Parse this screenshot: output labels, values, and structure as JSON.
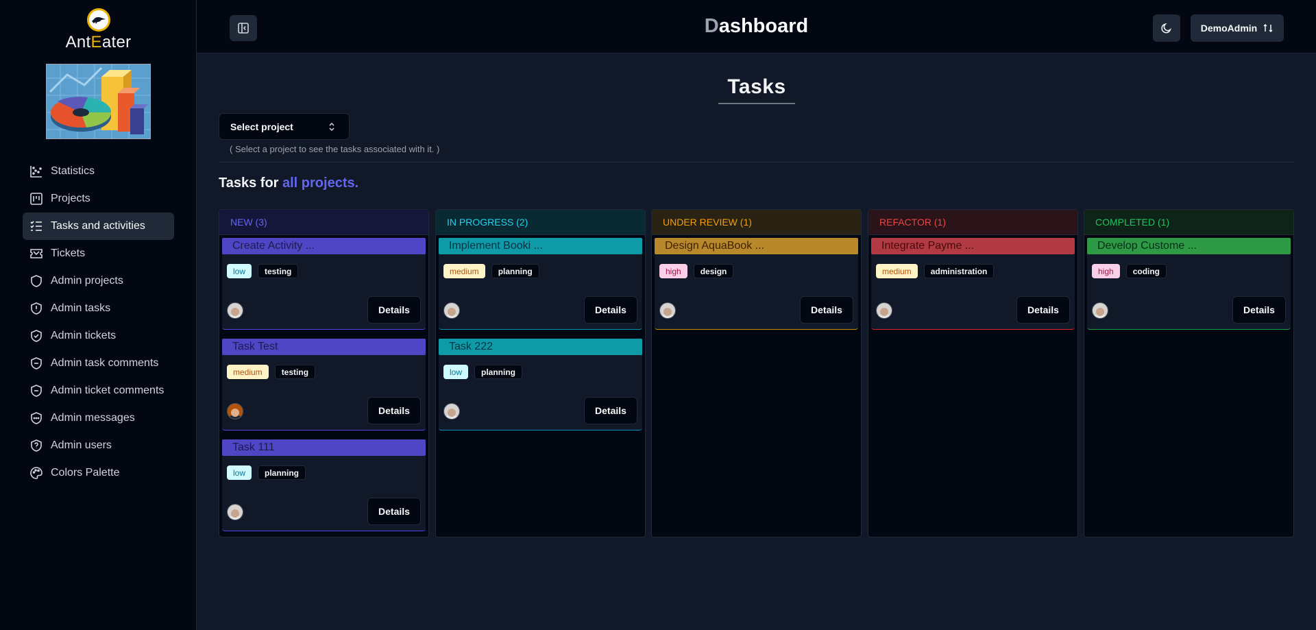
{
  "brand": {
    "name_start": "Ant",
    "name_e": "E",
    "name_end": "ater"
  },
  "sidebar": {
    "items": [
      {
        "label": "Statistics",
        "icon": "statistics-icon",
        "active": false
      },
      {
        "label": "Projects",
        "icon": "projects-icon",
        "active": false
      },
      {
        "label": "Tasks and activities",
        "icon": "tasks-icon",
        "active": true
      },
      {
        "label": "Tickets",
        "icon": "tickets-icon",
        "active": false
      },
      {
        "label": "Admin projects",
        "icon": "shield-icon",
        "active": false
      },
      {
        "label": "Admin tasks",
        "icon": "shield-alert-icon",
        "active": false
      },
      {
        "label": "Admin tickets",
        "icon": "shield-check-icon",
        "active": false
      },
      {
        "label": "Admin task comments",
        "icon": "shield-minus-icon",
        "active": false
      },
      {
        "label": "Admin ticket comments",
        "icon": "shield-minus-icon",
        "active": false
      },
      {
        "label": "Admin messages",
        "icon": "shield-ellipsis-icon",
        "active": false
      },
      {
        "label": "Admin users",
        "icon": "shield-question-icon",
        "active": false
      },
      {
        "label": "Colors Palette",
        "icon": "palette-icon",
        "active": false
      }
    ]
  },
  "header": {
    "title_first": "D",
    "title_rest": "ashboard",
    "user_label": "DemoAdmin"
  },
  "main": {
    "title": "Tasks",
    "select_label": "Select project",
    "select_hint": "( Select a project to see the tasks associated with it. )",
    "tasks_for_prefix": "Tasks for ",
    "tasks_for_highlight": "all projects.",
    "details_label": "Details"
  },
  "colors": {
    "new": "#4f46e5",
    "in_progress": "#0891b2",
    "under_review": "#ca8a04",
    "refactor": "#dc2626",
    "completed": "#16a34a"
  },
  "columns": [
    {
      "key": "new",
      "header": "NEW (3)",
      "header_color": "#6366f1",
      "header_bg": "#14163a",
      "card_bg": "#4f46c6",
      "title_color": "#1e1b4b",
      "border": "#4f46e5",
      "cards": [
        {
          "title": "Create Activity ...",
          "priority": "low",
          "category": "testing",
          "avatar": "default"
        },
        {
          "title": "Task Test",
          "priority": "medium",
          "category": "testing",
          "avatar": "alt"
        },
        {
          "title": "Task 111",
          "priority": "low",
          "category": "planning",
          "avatar": "default"
        }
      ]
    },
    {
      "key": "in_progress",
      "header": "IN PROGRESS (2)",
      "header_color": "#22d3ee",
      "header_bg": "#0a2a33",
      "card_bg": "#0e9aa7",
      "title_color": "#083344",
      "border": "#0891b2",
      "cards": [
        {
          "title": "Implement Booki ...",
          "priority": "medium",
          "category": "planning",
          "avatar": "default"
        },
        {
          "title": "Task 222",
          "priority": "low",
          "category": "planning",
          "avatar": "default"
        }
      ]
    },
    {
      "key": "under_review",
      "header": "UNDER REVIEW (1)",
      "header_color": "#f59e0b",
      "header_bg": "#2a2213",
      "card_bg": "#b8892a",
      "title_color": "#422006",
      "border": "#ca8a04",
      "cards": [
        {
          "title": "Design AquaBook ...",
          "priority": "high",
          "category": "design",
          "avatar": "default"
        }
      ]
    },
    {
      "key": "refactor",
      "header": "REFACTOR (1)",
      "header_color": "#ef4444",
      "header_bg": "#2a141a",
      "card_bg": "#b23a42",
      "title_color": "#450a0a",
      "border": "#dc2626",
      "cards": [
        {
          "title": "Integrate Payme ...",
          "priority": "medium",
          "category": "administration",
          "avatar": "default"
        }
      ]
    },
    {
      "key": "completed",
      "header": "COMPLETED (1)",
      "header_color": "#22c55e",
      "header_bg": "#0f2418",
      "card_bg": "#2f9a45",
      "title_color": "#052e16",
      "border": "#16a34a",
      "cards": [
        {
          "title": "Develop Custome ...",
          "priority": "high",
          "category": "coding",
          "avatar": "default"
        }
      ]
    }
  ]
}
